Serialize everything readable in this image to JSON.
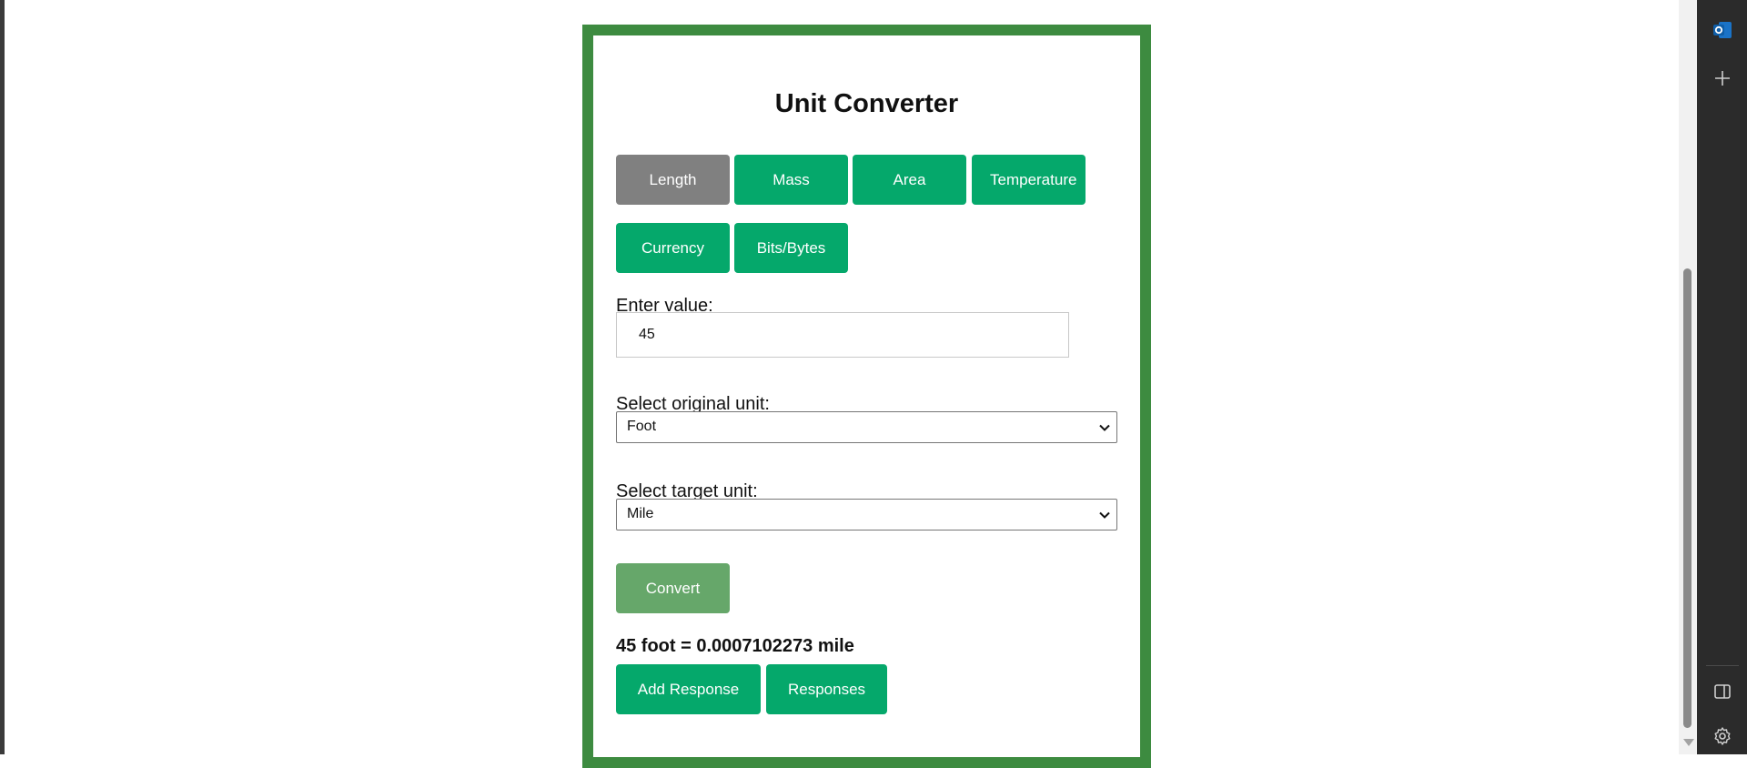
{
  "app": {
    "title": "Unit Converter"
  },
  "categories": [
    {
      "label": "Length",
      "active": true
    },
    {
      "label": "Mass",
      "active": false
    },
    {
      "label": "Area",
      "active": false
    },
    {
      "label": "Temperature",
      "active": false
    },
    {
      "label": "Currency",
      "active": false
    },
    {
      "label": "Bits/Bytes",
      "active": false
    }
  ],
  "form": {
    "value_label": "Enter value:",
    "value": "45",
    "original_label": "Select original unit:",
    "original_selected": "Foot",
    "target_label": "Select target unit:",
    "target_selected": "Mile",
    "convert_label": "Convert"
  },
  "result": {
    "text": "45 foot = 0.0007102273 mile"
  },
  "actions": {
    "add_response_label": "Add Response",
    "responses_label": "Responses"
  },
  "colors": {
    "accent": "#05a86b",
    "active_tab": "#808080",
    "convert": "#66a76a",
    "frame": "#3d8b40",
    "side_panel": "#2b2b2b"
  },
  "side_panel": {
    "icons": [
      "outlook-icon",
      "add-icon",
      "sidebar-toggle-icon",
      "settings-icon"
    ]
  }
}
